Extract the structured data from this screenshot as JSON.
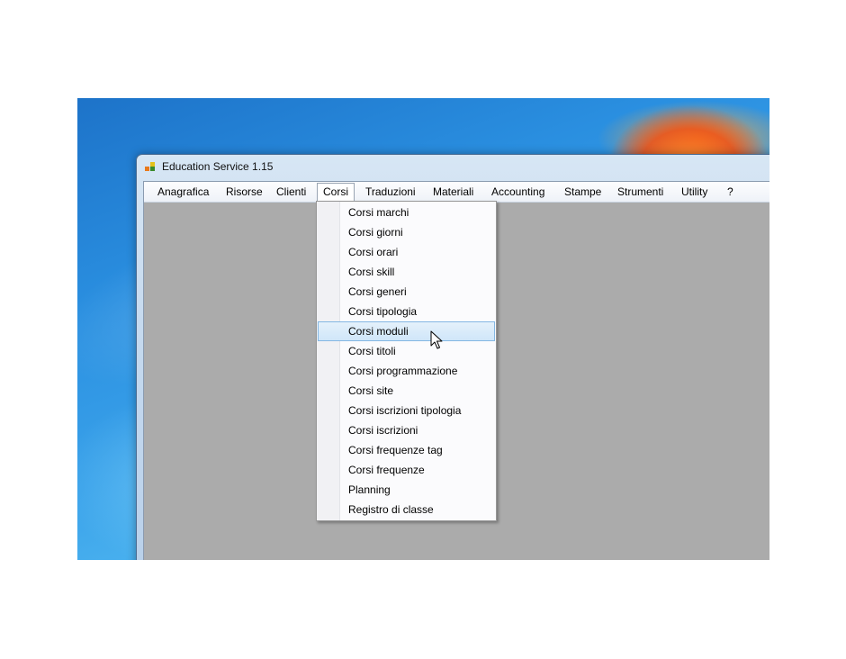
{
  "window": {
    "title": "Education Service 1.15"
  },
  "menubar": {
    "items": [
      {
        "label": "Anagrafica"
      },
      {
        "label": "Risorse"
      },
      {
        "label": "Clienti"
      },
      {
        "label": "Corsi"
      },
      {
        "label": "Traduzioni"
      },
      {
        "label": "Materiali"
      },
      {
        "label": "Accounting"
      },
      {
        "label": "Stampe"
      },
      {
        "label": "Strumenti"
      },
      {
        "label": "Utility"
      },
      {
        "label": "?"
      }
    ],
    "active": "Corsi"
  },
  "dropdown": {
    "items": [
      {
        "label": "Corsi marchi"
      },
      {
        "label": "Corsi giorni"
      },
      {
        "label": "Corsi orari"
      },
      {
        "label": "Corsi skill"
      },
      {
        "label": "Corsi generi"
      },
      {
        "label": "Corsi tipologia"
      },
      {
        "label": "Corsi moduli"
      },
      {
        "label": "Corsi titoli"
      },
      {
        "label": "Corsi programmazione"
      },
      {
        "label": "Corsi site"
      },
      {
        "label": "Corsi iscrizioni tipologia"
      },
      {
        "label": "Corsi iscrizioni"
      },
      {
        "label": "Corsi frequenze tag"
      },
      {
        "label": "Corsi frequenze"
      },
      {
        "label": "Planning"
      },
      {
        "label": "Registro di classe"
      }
    ],
    "highlighted": "Corsi moduli"
  },
  "icons": {
    "app": "app-icon",
    "pointer": "mouse-pointer-icon"
  },
  "colors": {
    "highlight": "#cfe6f9",
    "client_area": "#ababab"
  }
}
